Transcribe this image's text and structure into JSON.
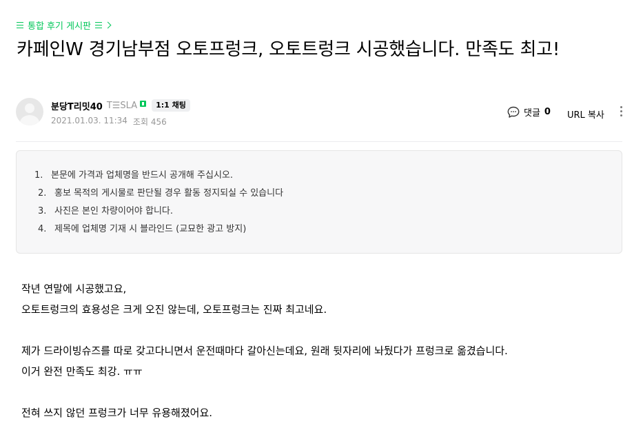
{
  "breadcrumb": {
    "board_name": "통합 후기 게시판"
  },
  "post": {
    "title": "카페인W 경기남부점 오토프렁크, 오토트렁크 시공했습니다. 만족도 최고!",
    "author": {
      "nickname": "분당T리밋40",
      "badge": "T☰SLA",
      "chat_label": "1:1 채팅"
    },
    "date": "2021.01.03. 11:34",
    "views": "조회 456",
    "comment_label": "댓글",
    "comment_count": "0",
    "url_copy_label": "URL 복사"
  },
  "notice": {
    "items": [
      {
        "num": "1.",
        "text": "본문에 가격과 업체명을 반드시 공개해 주십시오."
      },
      {
        "num": "2.",
        "text": "홍보 목적의 게시물로 판단될 경우 활동 정지되실 수 있습니다"
      },
      {
        "num": "3.",
        "text": "사진은 본인 차량이어야 합니다."
      },
      {
        "num": "4.",
        "text": "제목에 업체명 기재 시 블라인드 (교묘한 광고 방지)"
      }
    ]
  },
  "content": {
    "lines": [
      "작년 연말에 시공했고요,",
      "오토트렁크의 효용성은 크게 오진 않는데, 오토프렁크는 진짜 최고네요.",
      "",
      "제가 드라이빙슈즈를 따로 갖고다니면서 운전때마다 갈아신는데요, 원래 뒷자리에 놔뒀다가 프렁크로 옮겼습니다.",
      "이거 완전 만족도 최강. ㅠㅠ",
      "",
      "전혀 쓰지 않던 프렁크가 너무 유용해졌어요."
    ]
  },
  "colors": {
    "accent": "#03c75a",
    "meta_gray": "#979797",
    "notice_bg": "#f7f7f8"
  }
}
